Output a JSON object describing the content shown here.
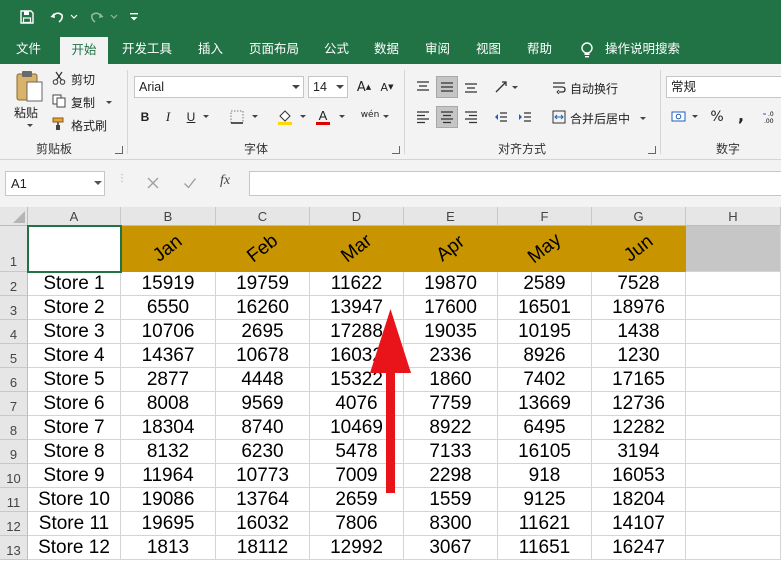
{
  "ribbon_tabs": [
    "文件",
    "开始",
    "开发工具",
    "插入",
    "页面布局",
    "公式",
    "数据",
    "审阅",
    "视图",
    "帮助"
  ],
  "tell_me": "操作说明搜索",
  "clipboard": {
    "paste": "粘贴",
    "cut": "剪切",
    "copy": "复制",
    "format_painter": "格式刷",
    "group": "剪贴板"
  },
  "font": {
    "name": "Arial",
    "size": "14",
    "group": "字体",
    "bold": "B",
    "italic": "I",
    "underline": "U",
    "grow": "A",
    "shrink": "A",
    "phonetic": "wén",
    "font_color_letter": "A",
    "highlight_color": "#ffd800",
    "font_color": "#e00000"
  },
  "alignment": {
    "wrap": "自动换行",
    "merge": "合并后居中",
    "group": "对齐方式"
  },
  "number": {
    "format": "常规",
    "percent": "%",
    "comma": ",",
    "group": "数字"
  },
  "formula_bar": {
    "name_box": "A1",
    "fx": "fx",
    "value": ""
  },
  "columns": [
    "A",
    "B",
    "C",
    "D",
    "E",
    "F",
    "G",
    "H"
  ],
  "header_row": {
    "row_number": "1",
    "months": [
      "Jan",
      "Feb",
      "Mar",
      "Apr",
      "May",
      "Jun"
    ],
    "fill_color": "#c89400"
  },
  "rows": [
    {
      "n": "2",
      "store": "Store 1",
      "vals": [
        "15919",
        "19759",
        "11622",
        "19870",
        "2589",
        "7528"
      ]
    },
    {
      "n": "3",
      "store": "Store 2",
      "vals": [
        "6550",
        "16260",
        "13947",
        "17600",
        "16501",
        "18976"
      ]
    },
    {
      "n": "4",
      "store": "Store 3",
      "vals": [
        "10706",
        "2695",
        "17288",
        "19035",
        "10195",
        "1438"
      ]
    },
    {
      "n": "5",
      "store": "Store 4",
      "vals": [
        "14367",
        "10678",
        "16032",
        "2336",
        "8926",
        "1230"
      ]
    },
    {
      "n": "6",
      "store": "Store 5",
      "vals": [
        "2877",
        "4448",
        "15322",
        "1860",
        "7402",
        "17165"
      ]
    },
    {
      "n": "7",
      "store": "Store 6",
      "vals": [
        "8008",
        "9569",
        "4076",
        "7759",
        "13669",
        "12736"
      ]
    },
    {
      "n": "8",
      "store": "Store 7",
      "vals": [
        "18304",
        "8740",
        "10469",
        "8922",
        "6495",
        "12282"
      ]
    },
    {
      "n": "9",
      "store": "Store 8",
      "vals": [
        "8132",
        "6230",
        "5478",
        "7133",
        "16105",
        "3194"
      ]
    },
    {
      "n": "10",
      "store": "Store 9",
      "vals": [
        "11964",
        "10773",
        "7009",
        "2298",
        "918",
        "16053"
      ]
    },
    {
      "n": "11",
      "store": "Store 10",
      "vals": [
        "19086",
        "13764",
        "2659",
        "1559",
        "9125",
        "18204"
      ]
    },
    {
      "n": "12",
      "store": "Store 11",
      "vals": [
        "19695",
        "16032",
        "7806",
        "8300",
        "11621",
        "14107"
      ]
    },
    {
      "n": "13",
      "store": "Store 12",
      "vals": [
        "1813",
        "18112",
        "12992",
        "3067",
        "11651",
        "16247"
      ]
    }
  ],
  "accent_color": "#217346",
  "annotation_arrow_color": "#e8141a"
}
